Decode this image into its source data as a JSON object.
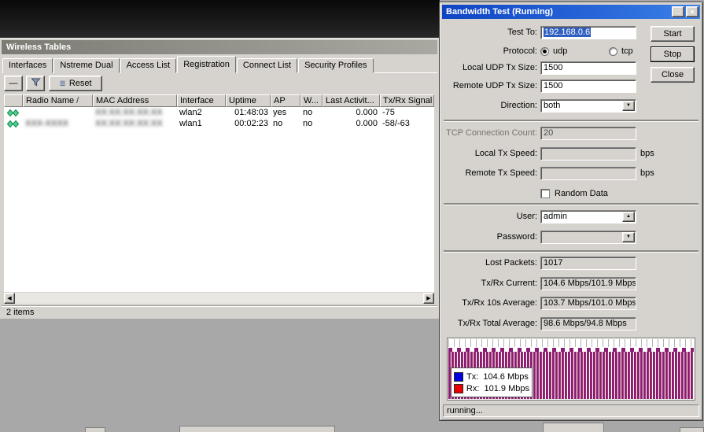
{
  "wireless_window": {
    "title": "Wireless Tables",
    "tabs": [
      "Interfaces",
      "Nstreme Dual",
      "Access List",
      "Registration",
      "Connect List",
      "Security Profiles"
    ],
    "toolbar": {
      "remove_icon": "—",
      "reset": "Reset",
      "reset_icon": "≣"
    },
    "table": {
      "headers": {
        "radio_name": "Radio Name",
        "sort": "/",
        "mac": "MAC Address",
        "interface": "Interface",
        "uptime": "Uptime",
        "ap": "AP",
        "w": "W...",
        "last_activity": "Last Activit...",
        "signal": "Tx/Rx Signal ..."
      },
      "rows": [
        {
          "radio_name": "",
          "mac": "XX:XX:XX:XX:XX",
          "interface": "wlan2",
          "uptime": "01:48:03",
          "ap": "yes",
          "w": "no",
          "last_activity": "0.000",
          "signal": "-75"
        },
        {
          "radio_name": "XXX-XXXX",
          "mac": "XX:XX:XX:XX:XX",
          "interface": "wlan1",
          "uptime": "00:02:23",
          "ap": "no",
          "w": "no",
          "last_activity": "0.000",
          "signal": "-58/-63"
        }
      ]
    },
    "status": "2 items"
  },
  "bandwidth_window": {
    "title": "Bandwidth Test (Running)",
    "window_icons": {
      "restore": "□",
      "close": "×"
    },
    "labels": {
      "test_to": "Test To:",
      "protocol": "Protocol:",
      "udp": "udp",
      "tcp": "tcp",
      "local_udp_tx_size": "Local UDP Tx Size:",
      "remote_udp_tx_size": "Remote UDP Tx Size:",
      "direction": "Direction:",
      "tcp_connection_count": "TCP Connection Count:",
      "local_tx_speed": "Local Tx Speed:",
      "remote_tx_speed": "Remote Tx Speed:",
      "bps": "bps",
      "random_data": "Random Data",
      "user": "User:",
      "password": "Password:",
      "lost_packets": "Lost Packets:",
      "tx_rx_current": "Tx/Rx Current:",
      "tx_rx_10s_average": "Tx/Rx 10s Average:",
      "tx_rx_total_average": "Tx/Rx Total Average:"
    },
    "values": {
      "test_to": "192.168.0.6",
      "protocol": "udp",
      "local_udp_tx_size": "1500",
      "remote_udp_tx_size": "1500",
      "direction": "both",
      "tcp_connection_count": "20",
      "local_tx_speed": "",
      "remote_tx_speed": "",
      "random_data_checked": false,
      "user": "admin",
      "password": "",
      "lost_packets": "1017",
      "tx_rx_current": "104.6 Mbps/101.9 Mbps",
      "tx_rx_10s_average": "103.7 Mbps/101.0 Mbps",
      "tx_rx_total_average": "98.6 Mbps/94.8 Mbps"
    },
    "buttons": {
      "start": "Start",
      "stop": "Stop",
      "close": "Close"
    },
    "chart": {
      "legend_tx": "Tx:  104.6 Mbps",
      "legend_rx": "Rx:  101.9 Mbps",
      "tx_color": "#0000e0",
      "rx_color": "#e80000",
      "bar_color": "#8a1c74"
    },
    "status": "running..."
  }
}
